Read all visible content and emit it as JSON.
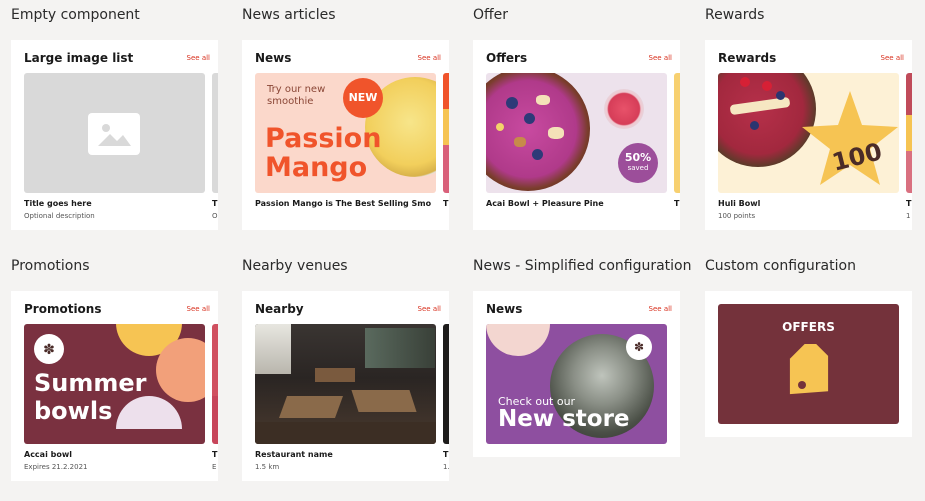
{
  "sections": {
    "s1": {
      "title": "Empty component",
      "card_title": "Large image list",
      "see_all": "See all",
      "item_title": "Title goes here",
      "item_desc": "Optional description",
      "peek_title": "T",
      "peek_sub": "O"
    },
    "s2": {
      "title": "News articles",
      "card_title": "News",
      "see_all": "See all",
      "tile_tagline": "Try our new smoothie",
      "tile_badge": "NEW",
      "tile_big_1": "Passion",
      "tile_big_2": "Mango",
      "item_title": "Passion Mango is The Best Selling Smoo…",
      "peek_title": "T"
    },
    "s3": {
      "title": "Offer",
      "card_title": "Offers",
      "see_all": "See all",
      "badge_pct": "50%",
      "badge_saved": "saved",
      "item_title": "Acai Bowl + Pleasure Pine",
      "peek_title": "T"
    },
    "s4": {
      "title": "Rewards",
      "card_title": "Rewards",
      "see_all": "See all",
      "star_points": "100",
      "item_title": "Huli Bowl",
      "item_desc": "100 points",
      "peek_title": "T",
      "peek_sub": "1"
    },
    "s5": {
      "title": "Promotions",
      "card_title": "Promotions",
      "see_all": "See all",
      "tile_big_1": "Summer",
      "tile_big_2": "bowls",
      "item_title": "Accai bowl",
      "item_desc": "Expires 21.2.2021",
      "peek_title": "T",
      "peek_sub": "E"
    },
    "s6": {
      "title": "Nearby venues",
      "card_title": "Nearby",
      "see_all": "See all",
      "item_title": "Restaurant name",
      "item_desc": "1.5 km",
      "peek_title": "T",
      "peek_sub": "1."
    },
    "s7": {
      "title": "News - Simplified configuration",
      "card_title": "News",
      "see_all": "See all",
      "tile_small": "Check out our",
      "tile_big": "New store"
    },
    "s8": {
      "title": "Custom configuration",
      "tile_label": "OFFERS"
    }
  },
  "colors": {
    "accent_red": "#d8301e",
    "passion_orange": "#f0542b",
    "promo_maroon": "#7a3140",
    "offer_purple": "#8e4fa0",
    "offers_maroon": "#74323b",
    "tag_yellow": "#f6c453"
  },
  "icons": {
    "placeholder": "image-placeholder-icon",
    "tag": "price-tag-icon",
    "logo": "palm-logo-icon"
  }
}
